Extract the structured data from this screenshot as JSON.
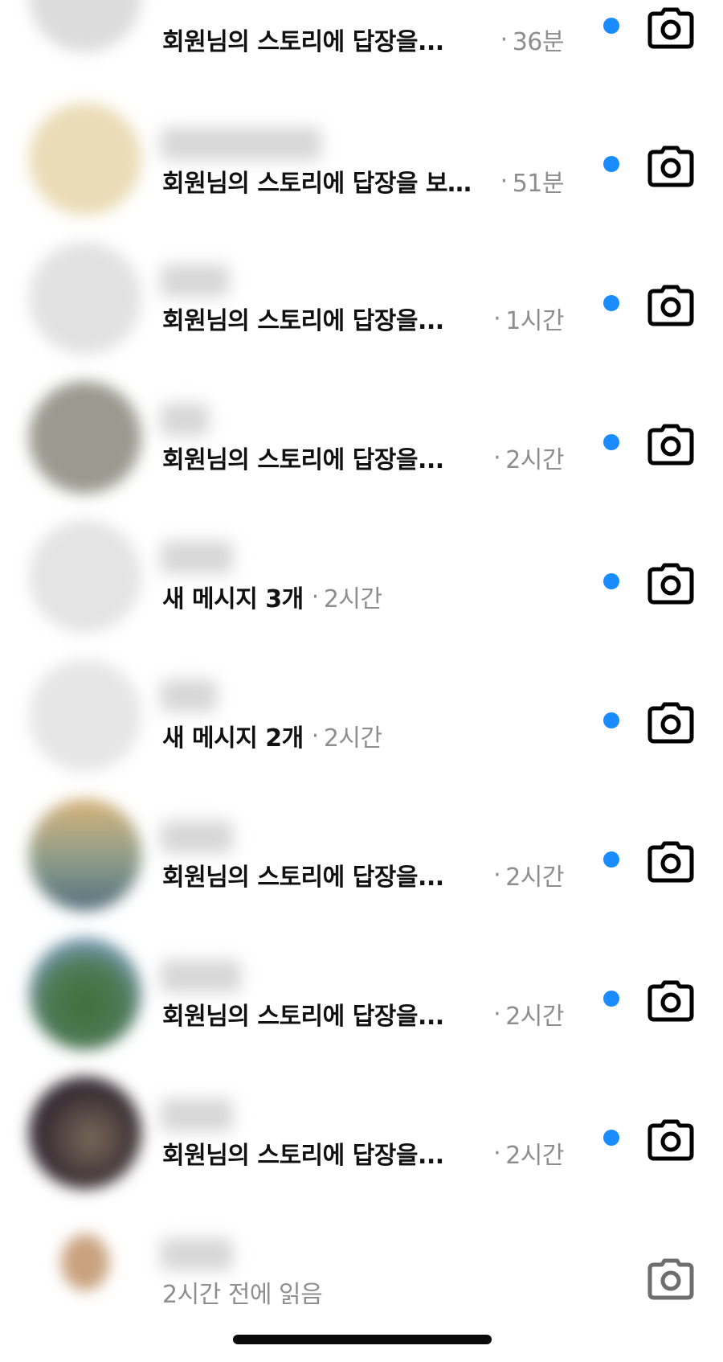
{
  "colors": {
    "unread_dot": "#1a8cff",
    "message_text": "#111111",
    "meta_text": "#8e8e8e",
    "camera_unread": "#000000",
    "camera_read": "#6e6e6e"
  },
  "icons": {
    "camera": "camera-icon",
    "unread": "unread-dot"
  },
  "conversations": [
    {
      "message": "회원님의 스토리에 답장을...",
      "separator": "·",
      "time": "36분",
      "unread": true
    },
    {
      "message": "회원님의 스토리에 답장을 보…",
      "separator": "·",
      "time": "51분",
      "unread": true
    },
    {
      "message": "회원님의 스토리에 답장을...",
      "separator": "·",
      "time": "1시간",
      "unread": true
    },
    {
      "message": "회원님의 스토리에 답장을...",
      "separator": "·",
      "time": "2시간",
      "unread": true
    },
    {
      "message": "새 메시지 3개",
      "separator": "·",
      "time": "2시간",
      "unread": true
    },
    {
      "message": "새 메시지 2개",
      "separator": "·",
      "time": "2시간",
      "unread": true
    },
    {
      "message": "회원님의 스토리에 답장을...",
      "separator": "·",
      "time": "2시간",
      "unread": true
    },
    {
      "message": "회원님의 스토리에 답장을...",
      "separator": "·",
      "time": "2시간",
      "unread": true
    },
    {
      "message": "회원님의 스토리에 답장을...",
      "separator": "·",
      "time": "2시간",
      "unread": true
    },
    {
      "message": "2시간 전에 읽음",
      "unread": false
    }
  ]
}
